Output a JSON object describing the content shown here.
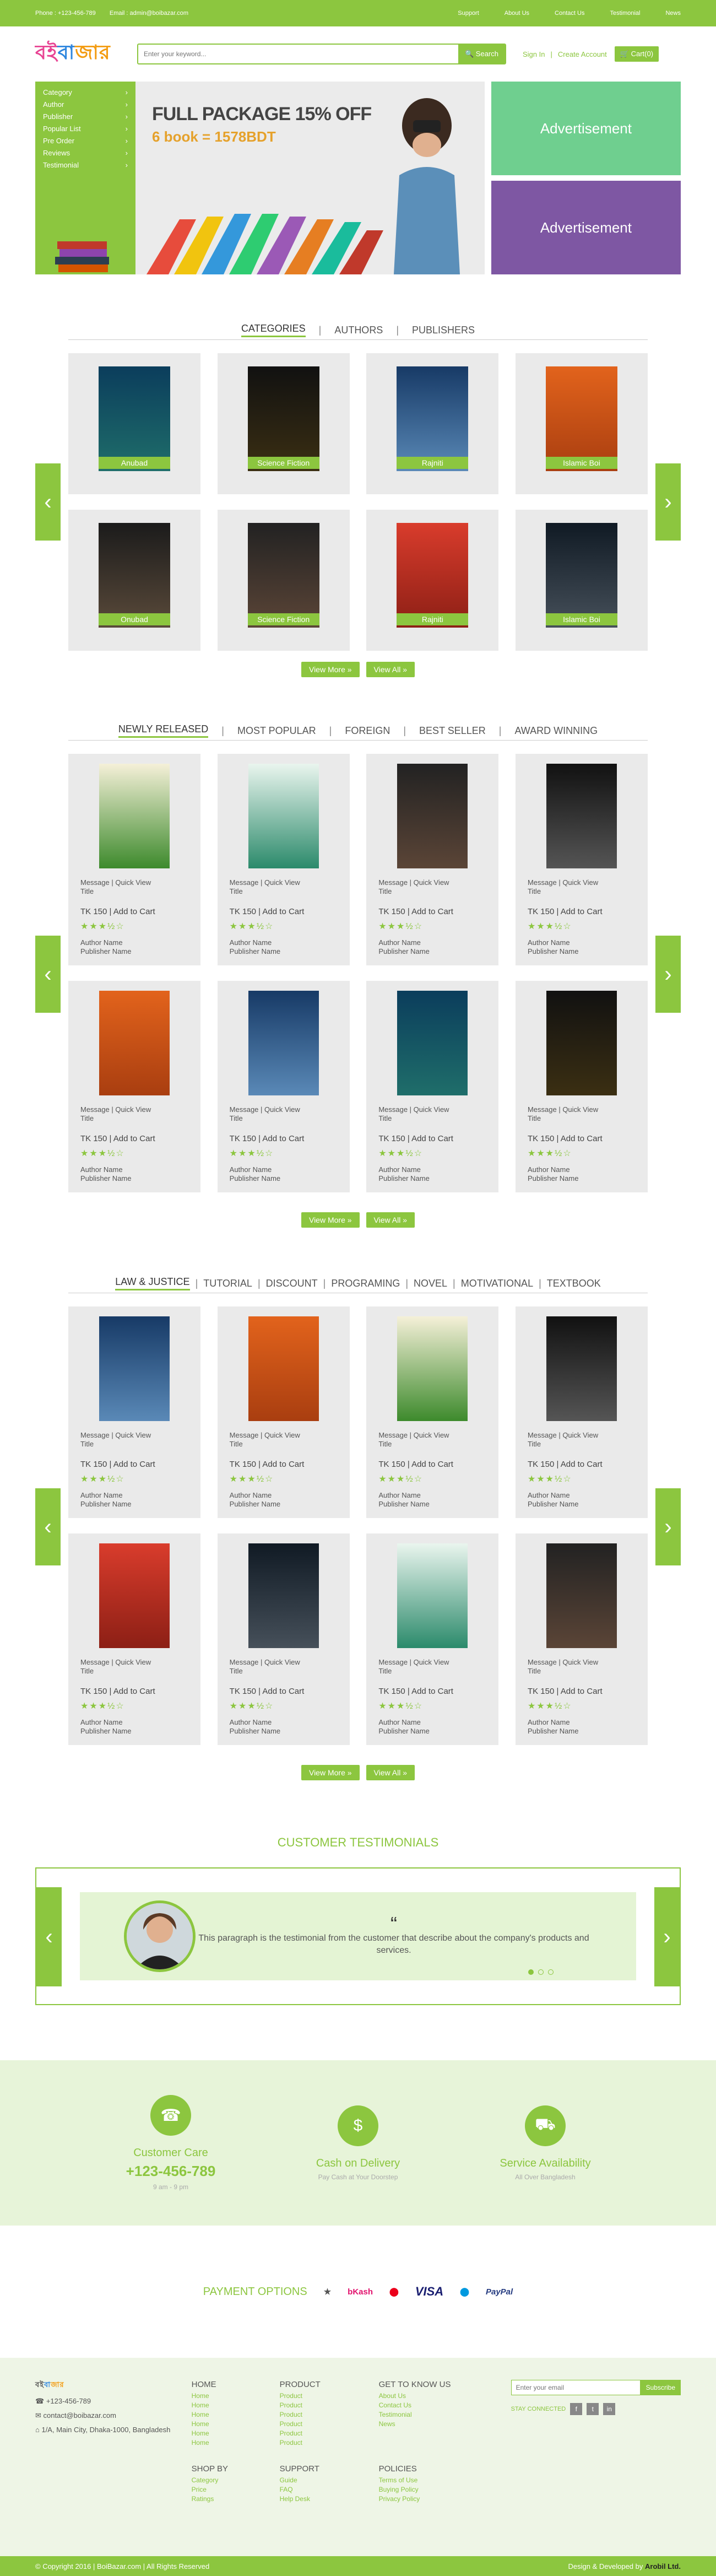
{
  "topbar": {
    "phone": "Phone : +123-456-789",
    "email": "Email : admin@boibazar.com",
    "links": [
      "Support",
      "About Us",
      "Contact Us",
      "Testimonial",
      "News"
    ]
  },
  "header": {
    "search_placeholder": "Enter your keyword...",
    "search_label": "Search",
    "signin": "Sign In",
    "create": "Create Account",
    "cart": "Cart(0)"
  },
  "menu": [
    "Category",
    "Author",
    "Publisher",
    "Popular List",
    "Pre Order",
    "Reviews",
    "Testimonial"
  ],
  "banner": {
    "title": "FULL PACKAGE 15% OFF",
    "subtitle": "6 book = 1578BDT"
  },
  "ads": [
    "Advertisement",
    "Advertisement"
  ],
  "tabs1": [
    "CATEGORIES",
    "AUTHORS",
    "PUBLISHERS"
  ],
  "categories": [
    "Anubad",
    "Science Fiction",
    "Rajniti",
    "Islamic Boi",
    "Onubad",
    "Science Fiction",
    "Rajniti",
    "Islamic Boi"
  ],
  "tabs2": [
    "NEWLY RELEASED",
    "MOST POPULAR",
    "FOREIGN",
    "BEST SELLER",
    "AWARD WINNING"
  ],
  "tabs3": [
    "LAW & JUSTICE",
    "TUTORIAL",
    "DISCOUNT",
    "PROGRAMING",
    "NOVEL",
    "MOTIVATIONAL",
    "TEXTBOOK"
  ],
  "product": {
    "actions": "Message  |  Quick View",
    "title": "Title",
    "price": "TK 150  |  Add to Cart",
    "author": "Author Name",
    "publisher": "Publisher Name"
  },
  "buttons": {
    "more": "View More »",
    "all": "View All »"
  },
  "testimonials": {
    "title": "CUSTOMER TESTIMONIALS",
    "text": "This paragraph is the testimonial from the customer that describe about the company's products and services."
  },
  "features": [
    {
      "title": "Customer Care",
      "big": "+123-456-789",
      "small": "9 am - 9 pm"
    },
    {
      "title": "Cash on Delivery",
      "big": "",
      "small": "Pay Cash at Your Doorstep"
    },
    {
      "title": "Service Availability",
      "big": "",
      "small": "All Over Bangladesh"
    }
  ],
  "payment": {
    "label": "PAYMENT OPTIONS",
    "logos": [
      "bKash",
      "MasterCard",
      "VISA",
      "Maestro",
      "PayPal"
    ]
  },
  "footer": {
    "phone": "+123-456-789",
    "email": "contact@boibazar.com",
    "address": "1/A, Main City, Dhaka-1000, Bangladesh",
    "home": {
      "title": "HOME",
      "items": [
        "Home",
        "Home",
        "Home",
        "Home",
        "Home",
        "Home"
      ]
    },
    "product": {
      "title": "PRODUCT",
      "items": [
        "Product",
        "Product",
        "Product",
        "Product",
        "Product",
        "Product"
      ]
    },
    "know": {
      "title": "GET TO KNOW US",
      "items": [
        "About Us",
        "Contact Us",
        "Testimonial",
        "News"
      ]
    },
    "shop": {
      "title": "SHOP BY",
      "items": [
        "Category",
        "Price",
        "Ratings"
      ]
    },
    "support": {
      "title": "SUPPORT",
      "items": [
        "Guide",
        "FAQ",
        "Help Desk"
      ]
    },
    "policies": {
      "title": "POLICIES",
      "items": [
        "Terms of Use",
        "Buying Policy",
        "Privacy Policy"
      ]
    },
    "email_placeholder": "Enter your email",
    "subscribe": "Subscribe",
    "stay": "STAY CONNECTED"
  },
  "bottom": {
    "copy": "© Copyright 2016 | BoiBazar.com | All Rights Reserved",
    "dev": "Design & Developed by",
    "devname": "Arobil Ltd."
  },
  "colors": {
    "accent": "#8cc63f",
    "ad1": "#6fcf8f",
    "ad2": "#7e57a3"
  }
}
